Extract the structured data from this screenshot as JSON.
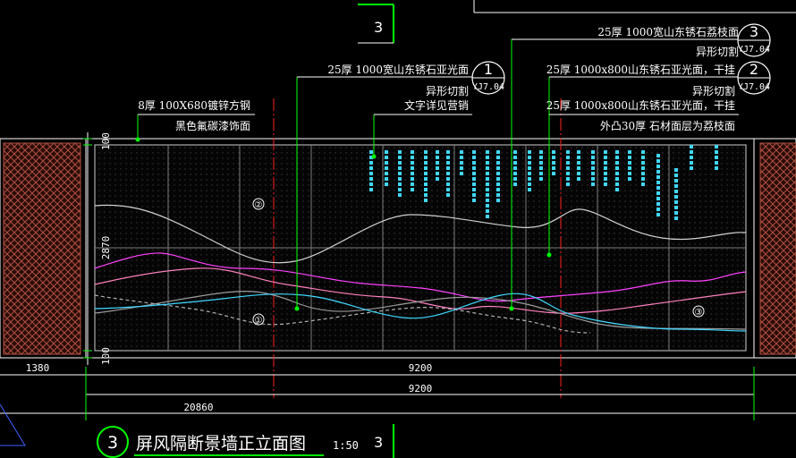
{
  "drawing": {
    "top_marker": "3",
    "callout_1": {
      "number": "1",
      "ref": "YJ7.04",
      "line1": "25厚 1000宽山东锈石亚光面",
      "line2": "异形切割",
      "line3": "文字详见营销"
    },
    "callout_2": {
      "number": "2",
      "ref": "YJ7.04",
      "line1": "25厚 1000x800山东锈石亚光面，干挂",
      "line2": "异形切割",
      "line3": "25厚 1000x800山东锈石亚光面，干挂",
      "line4": "外凸30厚 石材面层为荔枝面"
    },
    "callout_3": {
      "number": "3",
      "ref": "YJ7.04",
      "line1": "25厚 1000宽山东锈石荔枝面",
      "line2": "异形切割"
    },
    "steel_note": {
      "line1": "8厚 100X680镀锌方钢",
      "line2": "黑色氟碳漆饰面"
    },
    "dims": {
      "top_margin": "100",
      "height": "2870",
      "bottom_margin": "100",
      "left_panel": "1380",
      "wall_width": "9200",
      "wall_width_2": "9200",
      "total": "20860"
    },
    "wave_labels": {
      "w1": "①",
      "w2": "②",
      "w3": "③"
    },
    "title": {
      "number": "3",
      "text": "屏风隔断景墙正立面图",
      "scale": "1:50",
      "suffix": "3"
    },
    "colors": {
      "line": "#ffffff",
      "green": "#00ff00",
      "red": "#ff2020",
      "magenta": "#ff40ff",
      "cyan": "#40d8ff",
      "brown": "#b05040",
      "grid": "#7a7a7a"
    }
  }
}
